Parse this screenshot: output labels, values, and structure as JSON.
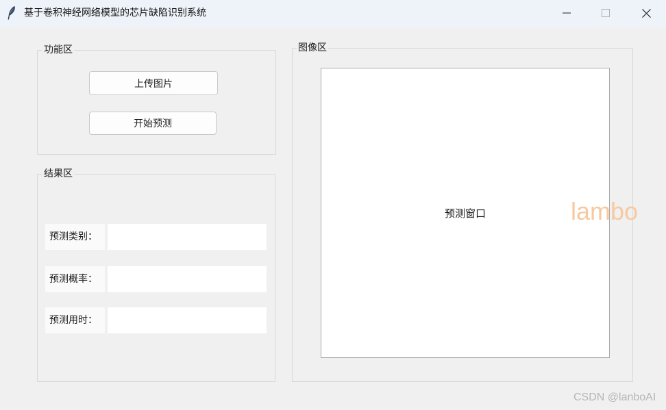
{
  "window": {
    "title": "基于卷积神经网络模型的芯片缺陷识别系统",
    "app_icon": "feather-icon",
    "controls": [
      "minimize-icon",
      "maximize-icon",
      "close-icon"
    ]
  },
  "function_area": {
    "label": "功能区",
    "upload_button": "上传图片",
    "predict_button": "开始预测"
  },
  "result_area": {
    "label": "结果区",
    "rows": [
      {
        "label": "预测类别：",
        "value": ""
      },
      {
        "label": "预测概率：",
        "value": ""
      },
      {
        "label": "预测用时：",
        "value": ""
      }
    ]
  },
  "image_area": {
    "label": "图像区",
    "canvas_text": "预测窗口"
  },
  "watermarks": {
    "lambo": "lambo",
    "csdn": "CSDN @lanboAI"
  },
  "colors": {
    "background": "#f0f0f0",
    "titlebar": "#eef3fa",
    "watermark_accent": "#f6c9a0"
  }
}
